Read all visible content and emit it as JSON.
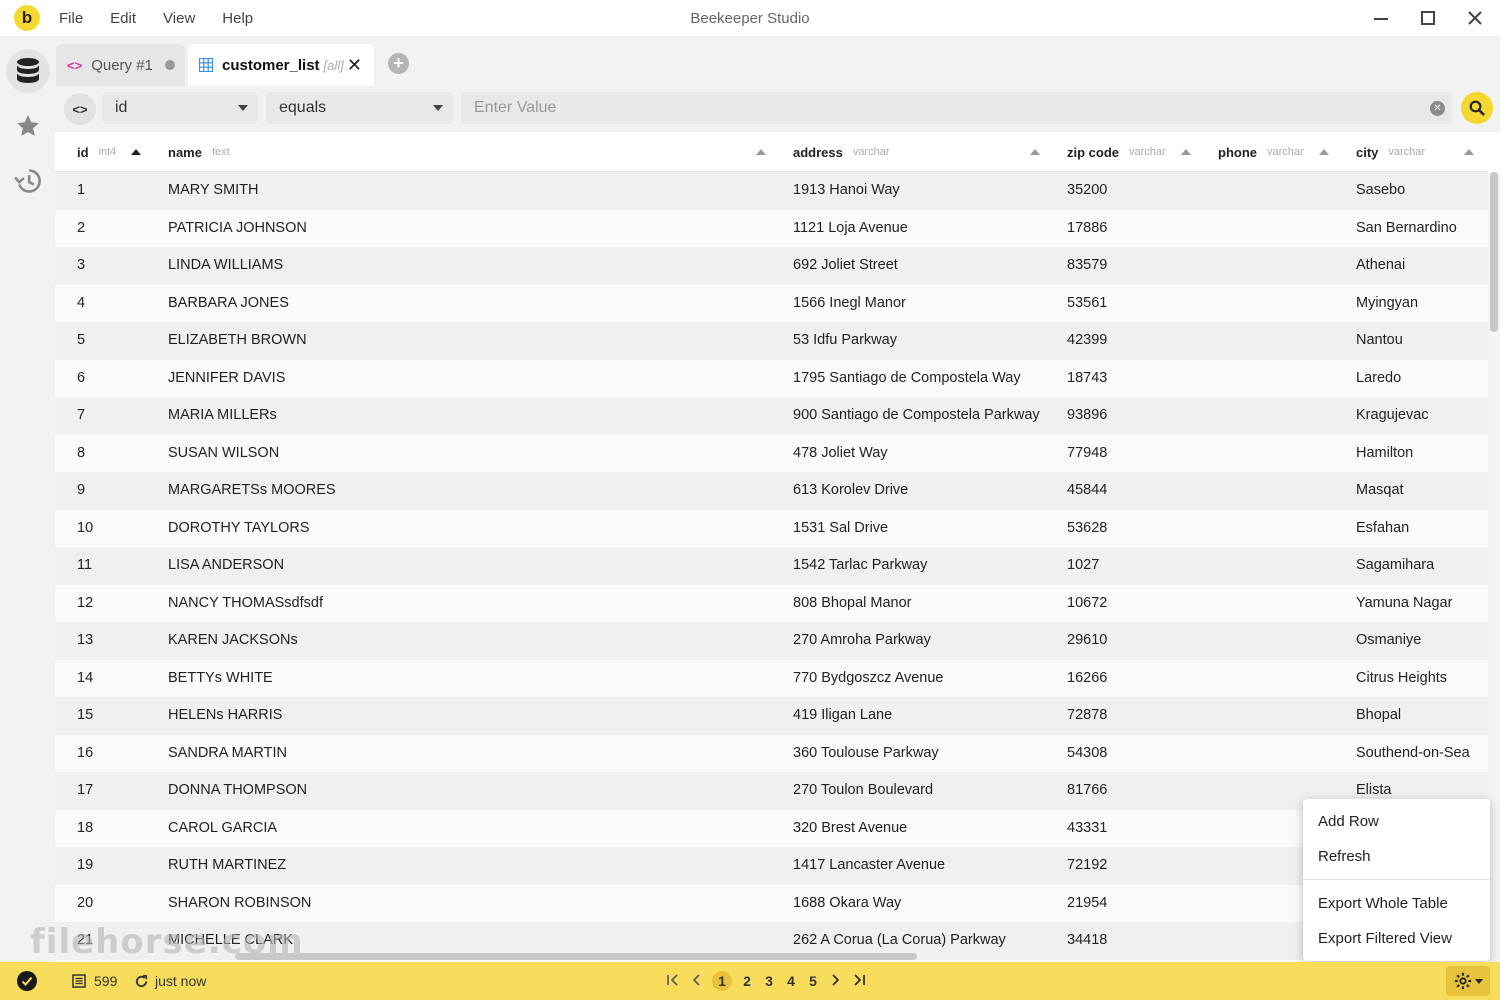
{
  "app": {
    "logo_letter": "b",
    "title": "Beekeeper Studio",
    "menu": [
      "File",
      "Edit",
      "View",
      "Help"
    ]
  },
  "tabs": {
    "query_label": "Query #1",
    "table_label": "customer_list",
    "table_scope": "[all]"
  },
  "filter": {
    "field": "id",
    "operator": "equals",
    "value_placeholder": "Enter Value"
  },
  "columns": [
    {
      "name": "id",
      "type": "int4"
    },
    {
      "name": "name",
      "type": "text"
    },
    {
      "name": "address",
      "type": "varchar"
    },
    {
      "name": "zip code",
      "type": "varchar"
    },
    {
      "name": "phone",
      "type": "varchar"
    },
    {
      "name": "city",
      "type": "varchar"
    }
  ],
  "rows": [
    [
      "1",
      "MARY SMITH",
      "1913 Hanoi Way",
      "35200",
      "",
      "Sasebo"
    ],
    [
      "2",
      "PATRICIA JOHNSON",
      "1121 Loja Avenue",
      "17886",
      "",
      "San Bernardino"
    ],
    [
      "3",
      "LINDA WILLIAMS",
      "692 Joliet Street",
      "83579",
      "",
      "Athenai"
    ],
    [
      "4",
      "BARBARA JONES",
      "1566 Inegl Manor",
      "53561",
      "",
      "Myingyan"
    ],
    [
      "5",
      "ELIZABETH BROWN",
      "53 Idfu Parkway",
      "42399",
      "",
      "Nantou"
    ],
    [
      "6",
      "JENNIFER DAVIS",
      "1795 Santiago de Compostela Way",
      "18743",
      "",
      "Laredo"
    ],
    [
      "7",
      "MARIA MILLERs",
      "900 Santiago de Compostela Parkway",
      "93896",
      "",
      "Kragujevac"
    ],
    [
      "8",
      "SUSAN WILSON",
      "478 Joliet Way",
      "77948",
      "",
      "Hamilton"
    ],
    [
      "9",
      "MARGARETSs MOORES",
      "613 Korolev Drive",
      "45844",
      "",
      "Masqat"
    ],
    [
      "10",
      "DOROTHY TAYLORS",
      "1531 Sal Drive",
      "53628",
      "",
      "Esfahan"
    ],
    [
      "11",
      "LISA ANDERSON",
      "1542 Tarlac Parkway",
      "1027",
      "",
      "Sagamihara"
    ],
    [
      "12",
      "NANCY THOMASsdfsdf",
      "808 Bhopal Manor",
      "10672",
      "",
      "Yamuna Nagar"
    ],
    [
      "13",
      "KAREN JACKSONs",
      "270 Amroha Parkway",
      "29610",
      "",
      "Osmaniye"
    ],
    [
      "14",
      "BETTYs WHITE",
      "770 Bydgoszcz Avenue",
      "16266",
      "",
      "Citrus Heights"
    ],
    [
      "15",
      "HELENs HARRIS",
      "419 Iligan Lane",
      "72878",
      "",
      "Bhopal"
    ],
    [
      "16",
      "SANDRA MARTIN",
      "360 Toulouse Parkway",
      "54308",
      "",
      "Southend-on-Sea"
    ],
    [
      "17",
      "DONNA THOMPSON",
      "270 Toulon Boulevard",
      "81766",
      "",
      "Elista"
    ],
    [
      "18",
      "CAROL GARCIA",
      "320 Brest Avenue",
      "43331",
      "",
      ""
    ],
    [
      "19",
      "RUTH MARTINEZ",
      "1417 Lancaster Avenue",
      "72192",
      "",
      ""
    ],
    [
      "20",
      "SHARON ROBINSON",
      "1688 Okara Way",
      "21954",
      "",
      ""
    ],
    [
      "21",
      "MICHELLE CLARK",
      "262 A Corua (La Corua) Parkway",
      "34418",
      "",
      ""
    ]
  ],
  "context_menu": {
    "add_row": "Add Row",
    "refresh": "Refresh",
    "export_whole": "Export Whole Table",
    "export_filtered": "Export Filtered View"
  },
  "status": {
    "row_count": "599",
    "last_updated": "just now",
    "pages": [
      "1",
      "2",
      "3",
      "4",
      "5"
    ],
    "current_page": "1"
  },
  "watermark": "filehorse.com",
  "colors": {
    "accent": "#f5d82f",
    "statusbar": "#f8dd5c"
  }
}
